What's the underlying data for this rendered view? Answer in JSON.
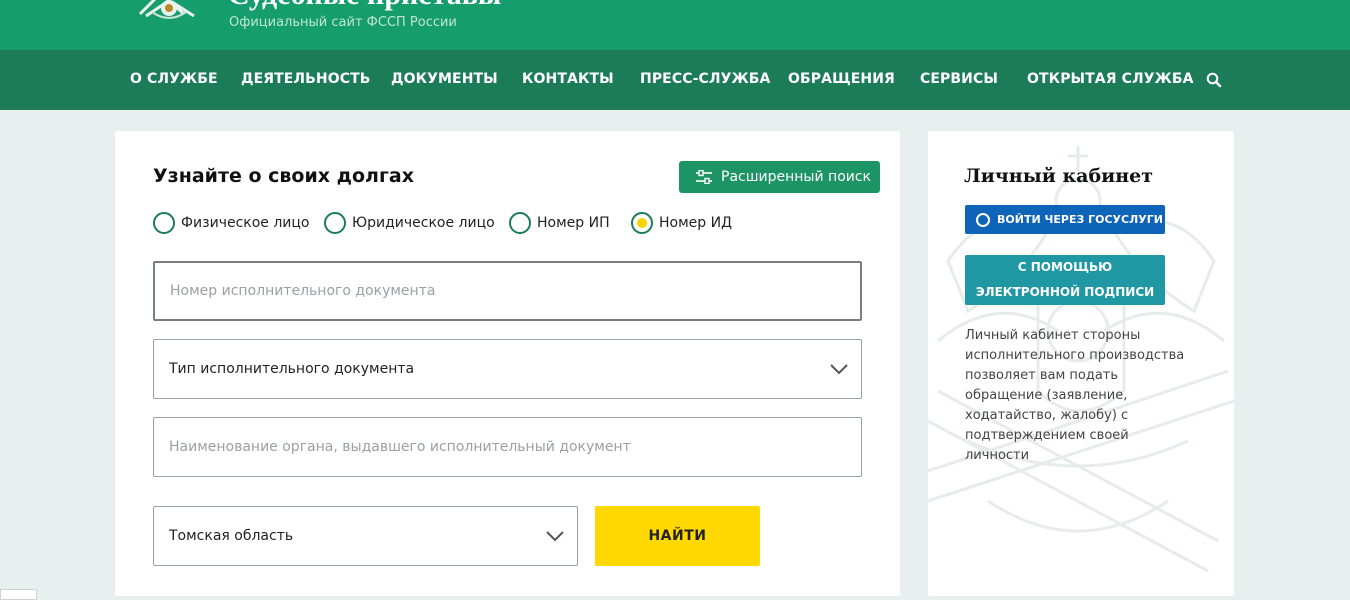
{
  "header": {
    "title": "Судебные приставы",
    "subtitle": "Официальный сайт ФССП России"
  },
  "nav": {
    "items": [
      "О СЛУЖБЕ",
      "ДЕЯТЕЛЬНОСТЬ",
      "ДОКУМЕНТЫ",
      "КОНТАКТЫ",
      "ПРЕСС-СЛУЖБА",
      "ОБРАЩЕНИЯ",
      "СЕРВИСЫ",
      "ОТКРЫТАЯ СЛУЖБА"
    ],
    "search_icon": "search-icon"
  },
  "search": {
    "title": "Узнайте о своих долгах",
    "advanced_label": "Расширенный поиск",
    "advanced_icon": "sliders-icon",
    "radio_options": [
      {
        "label": "Физическое лицо",
        "checked": false
      },
      {
        "label": "Юридическое лицо",
        "checked": false
      },
      {
        "label": "Номер ИП",
        "checked": false
      },
      {
        "label": "Номер ИД",
        "checked": true
      }
    ],
    "doc_number_placeholder": "Номер исполнительного документа",
    "doc_type_value": "Тип исполнительного документа",
    "issuer_placeholder": "Наименование органа, выдавшего исполнительный документ",
    "region_value": "Томская область",
    "find_label": "НАЙТИ"
  },
  "cabinet": {
    "title": "Личный кабинет",
    "gosuslugi_label": "ВОЙТИ ЧЕРЕЗ ГОСУСЛУГИ",
    "signature_line1": "С ПОМОЩЬЮ",
    "signature_line2": "ЭЛЕКТРОННОЙ ПОДПИСИ",
    "description": "Личный кабинет стороны исполнительного производства позволяет вам подать обращение (заявление, ходатайство, жалобу) с подтверждением своей личности"
  },
  "colors": {
    "header_green": "#159d6c",
    "nav_green": "#1c7c58",
    "button_green": "#1c9465",
    "find_yellow": "#ffd800",
    "gosuslugi_blue": "#0d64b8",
    "signature_teal": "#1f98a4"
  }
}
